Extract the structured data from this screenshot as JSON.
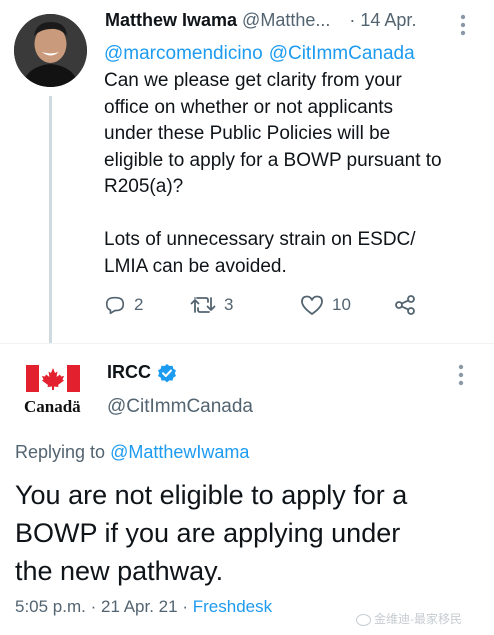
{
  "tweet1": {
    "author_name": "Matthew Iwama",
    "author_handle": "@Matthe...",
    "separator": "·",
    "date": "14 Apr.",
    "mentions": [
      "@marcomendicino",
      "@CitImmCanada"
    ],
    "text": "Can we please get clarity from your\noffice on whether or not applicants\nunder these Public Policies will be\neligible to apply for a BOWP pursuant to\nR205(a)?\n\nLots of unnecessary strain on ESDC/\nLMIA can be avoided.",
    "replies": "2",
    "retweets": "3",
    "likes": "10",
    "icons": [
      "reply-icon",
      "retweet-icon",
      "like-icon",
      "share-icon",
      "more-icon"
    ]
  },
  "tweet2": {
    "author_name": "IRCC",
    "author_handle": "@CitImmCanada",
    "verified": true,
    "logo_wordmark": "Canadä",
    "replying_prefix": "Replying to",
    "replying_user": "@MatthewIwama",
    "text": "You are not eligible to apply for a\nBOWP if you are applying under\nthe new pathway.",
    "time": "5:05 p.m.",
    "separator": "·",
    "date": "21 Apr. 21",
    "source": "Freshdesk",
    "icons": [
      "verified-badge-icon",
      "canada-flag-icon",
      "more-icon"
    ]
  },
  "watermark": "金维迪-最家移民",
  "colors": {
    "link": "#1d9bf0",
    "muted": "#536471",
    "text": "#0f1419",
    "flag_red": "#e3202d",
    "verified": "#1d9bf0"
  }
}
